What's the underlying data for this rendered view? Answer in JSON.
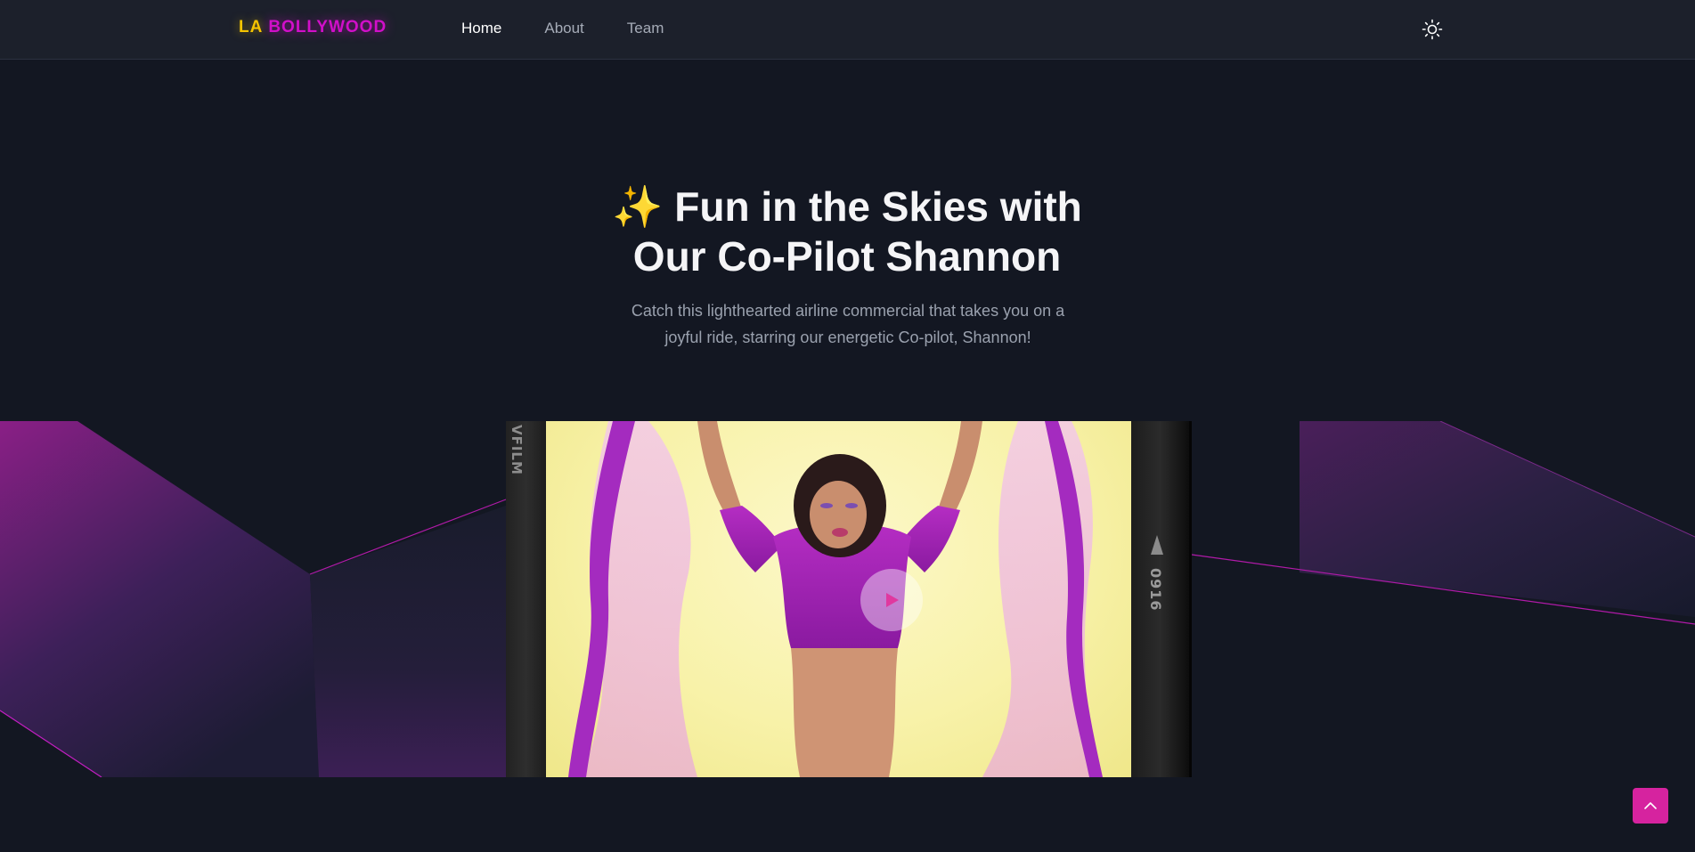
{
  "header": {
    "logo_prefix": "LA",
    "logo_name": "BOLLYWOOD",
    "nav": [
      {
        "label": "Home",
        "active": true
      },
      {
        "label": "About",
        "active": false
      },
      {
        "label": "Team",
        "active": false
      }
    ],
    "theme_toggle_icon": "sun-icon"
  },
  "hero": {
    "title_emoji": "✨",
    "title_line1": "Fun in the Skies with",
    "title_line2": "Our Co-Pilot Shannon",
    "subtitle_line1": "Catch this lighthearted airline commercial that takes you on a",
    "subtitle_line2": "joyful ride, starring our energetic Co-pilot, Shannon!"
  },
  "video": {
    "film_edge_left": "VFILM",
    "film_edge_right": "0916",
    "play_icon": "play-icon"
  },
  "back_to_top_icon": "chevron-up-icon",
  "colors": {
    "background": "#131722",
    "header": "#1c202b",
    "logo_yellow": "#f5c400",
    "logo_magenta": "#d10fc9",
    "accent_pink": "#d6239f",
    "backdrop_yellow": "#f8f2a9"
  }
}
